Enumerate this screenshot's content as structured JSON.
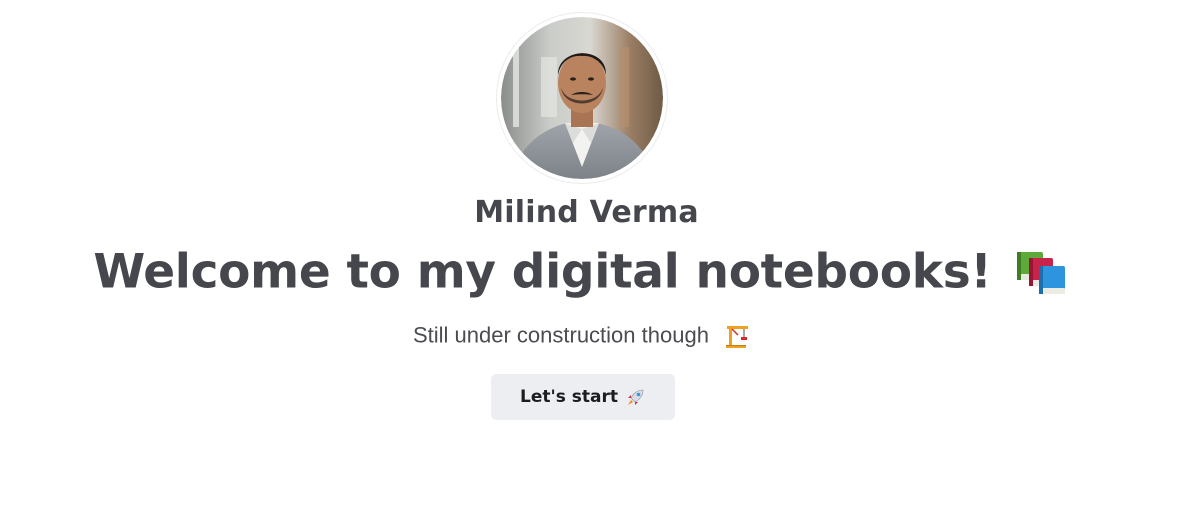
{
  "profile": {
    "name": "Milind Verma",
    "avatar_icon": "profile-photo"
  },
  "hero": {
    "title": "Welcome to my digital notebooks!",
    "title_icon": "books-icon",
    "subtitle": "Still under construction though",
    "subtitle_icon": "construction-crane-icon"
  },
  "cta": {
    "label": "Let's start",
    "icon": "rocket-icon"
  },
  "colors": {
    "text": "#45474d",
    "button_bg": "#edeef2",
    "background": "#ffffff"
  }
}
